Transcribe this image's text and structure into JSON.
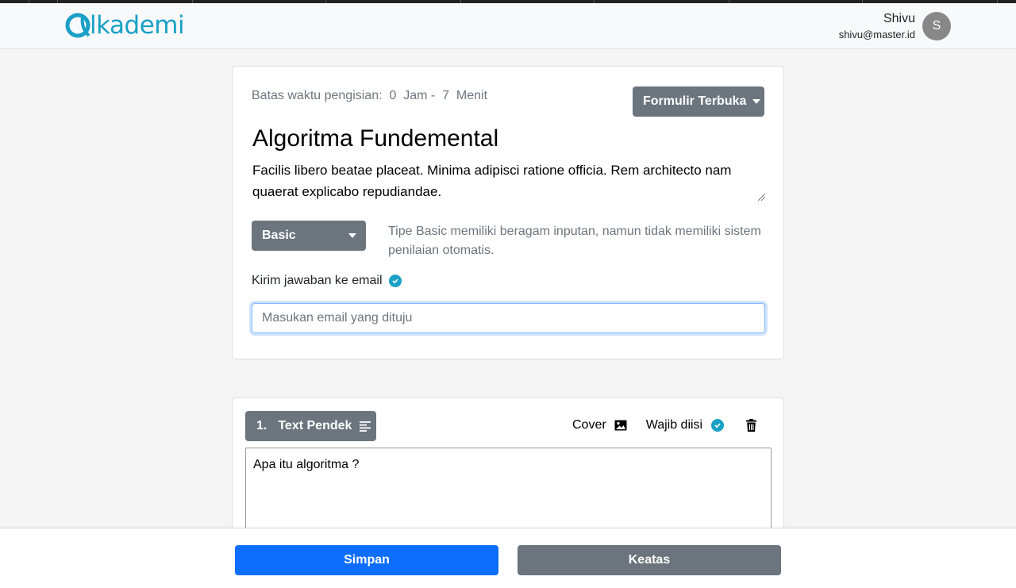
{
  "brand": {
    "logo_text": "lkademi",
    "accent_color": "#1aa0c6"
  },
  "user": {
    "name": "Shivu",
    "email": "shivu@master.id",
    "avatar_initial": "S"
  },
  "form": {
    "deadline_label": "Batas waktu pengisian:",
    "deadline_hours": "0",
    "deadline_hours_unit": "Jam -",
    "deadline_minutes": "7",
    "deadline_minutes_unit": "Menit",
    "status_button": "Formulir Terbuka",
    "title": "Algoritma Fundemental",
    "description": "Facilis libero beatae placeat. Minima adipisci ratione officia. Rem architecto nam quaerat explicabo repudiandae.",
    "type_select": "Basic",
    "type_hint": "Tipe Basic memiliki beragam inputan, namun tidak memiliki sistem penilaian otomatis.",
    "send_email_label": "Kirim jawaban ke email",
    "email_placeholder": "Masukan email yang dituju"
  },
  "question": {
    "number": "1.",
    "type_label": "Text Pendek",
    "cover_label": "Cover",
    "required_label": "Wajib diisi",
    "text": "Apa itu algoritma ?"
  },
  "footer": {
    "save_label": "Simpan",
    "top_label": "Keatas"
  },
  "colors": {
    "primary": "#0d6efd",
    "secondary": "#6c757d"
  },
  "icons": [
    "logo-icon",
    "caret-down-icon",
    "check-circle-icon",
    "text-lines-icon",
    "image-icon",
    "trash-icon"
  ]
}
